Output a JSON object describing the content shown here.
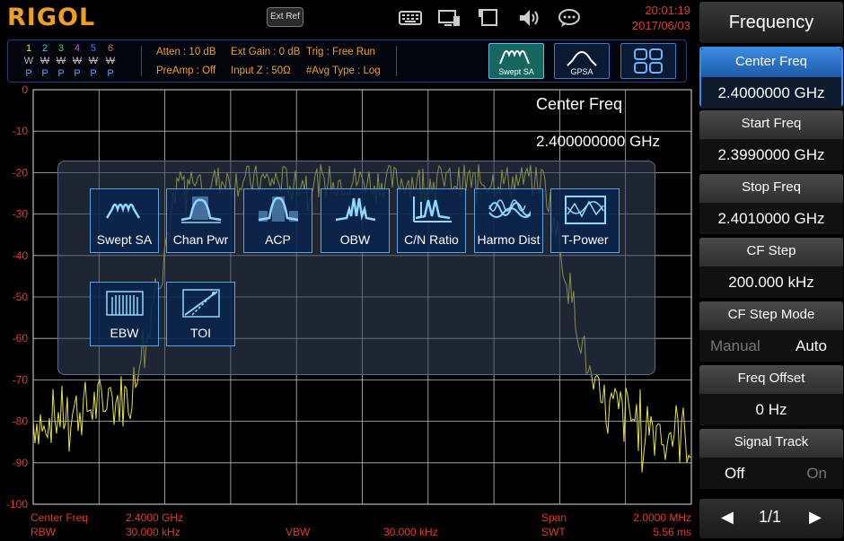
{
  "logo": "RIGOL",
  "ext_ref": "Ext Ref",
  "clock": {
    "time": "20:01:19",
    "date": "2017/06/03"
  },
  "traces": [
    {
      "num": "1",
      "mode": "W",
      "det": "P",
      "color": "#e8e337"
    },
    {
      "num": "2",
      "mode": "W",
      "det": "P",
      "color": "#2fd0e0"
    },
    {
      "num": "3",
      "mode": "W",
      "det": "P",
      "color": "#2ee63a"
    },
    {
      "num": "4",
      "mode": "W",
      "det": "P",
      "color": "#e03ce8"
    },
    {
      "num": "5",
      "mode": "W",
      "det": "P",
      "color": "#4a78ff"
    },
    {
      "num": "6",
      "mode": "W",
      "det": "P",
      "color": "#f07820"
    }
  ],
  "status": {
    "atten": "Atten : 10 dB",
    "ext_gain": "Ext Gain : 0 dB",
    "trig": "Trig : Free Run",
    "preamp": "PreAmp : Off",
    "input_z": "Input Z : 50Ω",
    "avg_type": "#Avg Type : Log"
  },
  "mode_buttons": [
    {
      "label": "Swept SA",
      "active": true
    },
    {
      "label": "GPSA",
      "active": false
    },
    {
      "label": "",
      "active": false
    }
  ],
  "plot": {
    "y_ticks": [
      "0",
      "-10",
      "-20",
      "-30",
      "-40",
      "-50",
      "-60",
      "-70",
      "-80",
      "-90",
      "-100"
    ],
    "trace_color": "#e8e337",
    "readout_label": "Center Freq",
    "readout_value": "2.400000000 GHz"
  },
  "measurements": [
    {
      "label": "Swept SA",
      "icon": "swept-sa-icon"
    },
    {
      "label": "Chan Pwr",
      "icon": "chan-pwr-icon"
    },
    {
      "label": "ACP",
      "icon": "acp-icon"
    },
    {
      "label": "OBW",
      "icon": "obw-icon"
    },
    {
      "label": "C/N Ratio",
      "icon": "cn-ratio-icon"
    },
    {
      "label": "Harmo Dist",
      "icon": "harmo-dist-icon"
    },
    {
      "label": "T-Power",
      "icon": "t-power-icon"
    },
    {
      "label": "EBW",
      "icon": "ebw-icon"
    },
    {
      "label": "TOI",
      "icon": "toi-icon"
    }
  ],
  "bottom": {
    "center_label": "Center Freq",
    "center_value": "2.4000 GHz",
    "span_label": "Span",
    "span_value": "2.0000 MHz",
    "rbw_label": "RBW",
    "rbw_value": "30.000 kHz",
    "vbw_label": "VBW",
    "vbw_value": "30.000 kHz",
    "swt_label": "SWT",
    "swt_value": "5.56 ms"
  },
  "menu": {
    "title": "Frequency",
    "keys": [
      {
        "label": "Center Freq",
        "value": "2.4000000 GHz",
        "selected": true
      },
      {
        "label": "Start Freq",
        "value": "2.3990000 GHz"
      },
      {
        "label": "Stop Freq",
        "value": "2.4010000 GHz"
      },
      {
        "label": "CF Step",
        "value": "200.000 kHz"
      },
      {
        "label": "CF Step Mode",
        "opt_a": "Manual",
        "opt_b": "Auto",
        "active": "opt_b"
      },
      {
        "label": "Freq Offset",
        "value": "0 Hz"
      },
      {
        "label": "Signal Track",
        "opt_a": "Off",
        "opt_b": "On",
        "active": "opt_a"
      }
    ],
    "page": "1/1"
  }
}
